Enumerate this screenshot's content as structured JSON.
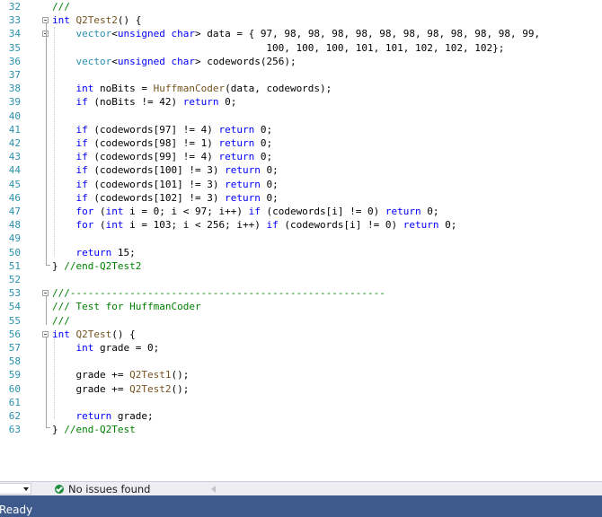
{
  "editor": {
    "lines": [
      {
        "n": "32",
        "html": "<span class=\"cmt\">///</span>"
      },
      {
        "n": "33",
        "html": "<span class=\"kw\">int</span> <span class=\"fn\">Q2Test2</span>() {",
        "fold": true
      },
      {
        "n": "34",
        "html": "    <span class=\"typ\">vector</span>&lt;<span class=\"kw\">unsigned</span> <span class=\"kw\">char</span>&gt; data = { 97, 98, 98, 98, 98, 98, 98, 98, 98, 98, 98, 99,",
        "fold": true
      },
      {
        "n": "35",
        "html": "                                    100, 100, 100, 101, 101, 102, 102, 102};"
      },
      {
        "n": "36",
        "html": "    <span class=\"typ\">vector</span>&lt;<span class=\"kw\">unsigned</span> <span class=\"kw\">char</span>&gt; codewords(256);"
      },
      {
        "n": "37",
        "html": ""
      },
      {
        "n": "38",
        "html": "    <span class=\"kw\">int</span> noBits = <span class=\"fn\">HuffmanCoder</span>(data, codewords);"
      },
      {
        "n": "39",
        "html": "    <span class=\"kw\">if</span> (noBits != 42) <span class=\"kw\">return</span> 0;"
      },
      {
        "n": "40",
        "html": ""
      },
      {
        "n": "41",
        "html": "    <span class=\"kw\">if</span> (codewords[97] != 4) <span class=\"kw\">return</span> 0;"
      },
      {
        "n": "42",
        "html": "    <span class=\"kw\">if</span> (codewords[98] != 1) <span class=\"kw\">return</span> 0;"
      },
      {
        "n": "43",
        "html": "    <span class=\"kw\">if</span> (codewords[99] != 4) <span class=\"kw\">return</span> 0;"
      },
      {
        "n": "44",
        "html": "    <span class=\"kw\">if</span> (codewords[100] != 3) <span class=\"kw\">return</span> 0;"
      },
      {
        "n": "45",
        "html": "    <span class=\"kw\">if</span> (codewords[101] != 3) <span class=\"kw\">return</span> 0;"
      },
      {
        "n": "46",
        "html": "    <span class=\"kw\">if</span> (codewords[102] != 3) <span class=\"kw\">return</span> 0;"
      },
      {
        "n": "47",
        "html": "    <span class=\"kw\">for</span> (<span class=\"kw\">int</span> i = 0; i &lt; 97; i++) <span class=\"kw\">if</span> (codewords[i] != 0) <span class=\"kw\">return</span> 0;"
      },
      {
        "n": "48",
        "html": "    <span class=\"kw\">for</span> (<span class=\"kw\">int</span> i = 103; i &lt; 256; i++) <span class=\"kw\">if</span> (codewords[i] != 0) <span class=\"kw\">return</span> 0;"
      },
      {
        "n": "49",
        "html": ""
      },
      {
        "n": "50",
        "html": "    <span class=\"kw\">return</span> 15;"
      },
      {
        "n": "51",
        "html": "} <span class=\"cmt\">//end-Q2Test2</span>"
      },
      {
        "n": "52",
        "html": ""
      },
      {
        "n": "53",
        "html": "<span class=\"cmt\">///-----------------------------------------------------</span>",
        "fold": true
      },
      {
        "n": "54",
        "html": "<span class=\"cmt\">/// Test for HuffmanCoder</span>"
      },
      {
        "n": "55",
        "html": "<span class=\"cmt\">///</span>"
      },
      {
        "n": "56",
        "html": "<span class=\"kw\">int</span> <span class=\"fn\">Q2Test</span>() {",
        "fold": true
      },
      {
        "n": "57",
        "html": "    <span class=\"kw\">int</span> grade = 0;"
      },
      {
        "n": "58",
        "html": ""
      },
      {
        "n": "59",
        "html": "    grade += <span class=\"fn\">Q2Test1</span>();"
      },
      {
        "n": "60",
        "html": "    grade += <span class=\"fn\">Q2Test2</span>();"
      },
      {
        "n": "61",
        "html": ""
      },
      {
        "n": "62",
        "html": "    <span class=\"kw\">return</span> grade;"
      },
      {
        "n": "63",
        "html": "} <span class=\"cmt\">//end-Q2Test</span>"
      }
    ]
  },
  "status_strip": {
    "zoom_value": "",
    "issues": "No issues found"
  },
  "statusbar": {
    "text": "Ready"
  },
  "colors": {
    "statusbar_bg": "#3e5a8c",
    "keyword": "#0000ff",
    "type": "#2b91af",
    "comment": "#008000",
    "function": "#74531f",
    "issues_ok": "#1e8e3e"
  }
}
